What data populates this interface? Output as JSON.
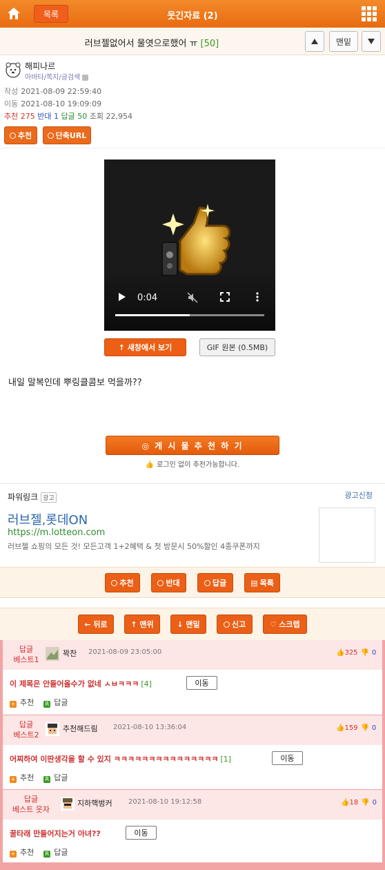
{
  "header": {
    "list_label": "목록",
    "board_title": "웃긴자료 (2)"
  },
  "post": {
    "title": "러브젤없어서 물엿으로했어 ㅠ",
    "comment_count": "[50]",
    "nav": {
      "bottom_label": "맨밑"
    }
  },
  "author": {
    "nickname": "해피나르",
    "links": "아바타/쪽지/글검색",
    "created_label": "작성",
    "created": "2021-08-09 22:59:40",
    "moved_label": "이동",
    "moved": "2021-08-10 19:09:09",
    "stats": {
      "rec_label": "추천",
      "rec": "275",
      "anti_label": "반대",
      "anti": "1",
      "reply_label": "답글",
      "reply": "50",
      "view_label": "조회",
      "view": "22,954"
    },
    "rec_button": "추천",
    "shorturl_button": "단축URL"
  },
  "video": {
    "time": "0:04",
    "progress": 0.5,
    "new_window": "↑ 새창에서 보기",
    "gif_original": "GIF 원본 (0.5MB)"
  },
  "content": {
    "text": "내일 말복인데 뿌링클콤보 먹을까??"
  },
  "recommend": {
    "button": "◎ 게 시 물   추 천 하 기",
    "note": "로그인 없이 추천가능합니다."
  },
  "ad": {
    "header": "파워링크",
    "badge": "광고",
    "apply": "광고신청",
    "title": "러브젤,롯데ON",
    "url": "https://m.lotteon.com",
    "desc": "러브젤 쇼핑의 모든 것! 모든고객 1+2혜택 & 첫 방문시 50%할인 4종쿠폰까지"
  },
  "actions1": {
    "recommend": "추천",
    "oppose": "반대",
    "reply": "답글",
    "list": "목록"
  },
  "actions2": {
    "back": "← 뒤로",
    "top": "↑ 맨위",
    "bottom": "↓ 맨밑",
    "report": "신고",
    "scrap": "스크랩"
  },
  "best_comments": [
    {
      "label_line1": "답글",
      "label_line2": "베스트1",
      "nick": "꽉찬",
      "time": "2021-08-09 23:05:00",
      "up": "325",
      "down": "0",
      "text": "이 제목은 안들어올수가 없네 ㅅㅂㅋㅋㅋ",
      "replies": "[4]",
      "move": "이동",
      "rec": "추천",
      "reply": "답글"
    },
    {
      "label_line1": "답글",
      "label_line2": "베스트2",
      "nick": "추천해드림",
      "time": "2021-08-10 13:36:04",
      "up": "159",
      "down": "0",
      "text": "어찌하여 이딴생각을 할 수 있지 ㅋㅋㅋㅋㅋㅋㅋㅋㅋㅋㅋㅋㅋㅋㅋ",
      "replies": "[1]",
      "move": "이동",
      "rec": "추천",
      "reply": "답글"
    },
    {
      "label_line1": "답글",
      "label_line2": "베스트 웃자",
      "nick": "지하핵벙커",
      "time": "2021-08-10 19:12:58",
      "up": "18",
      "down": "0",
      "text": "꿀타래 만들어지는거 아녀??",
      "replies": "",
      "move": "이동",
      "rec": "추천",
      "reply": "답글"
    }
  ]
}
